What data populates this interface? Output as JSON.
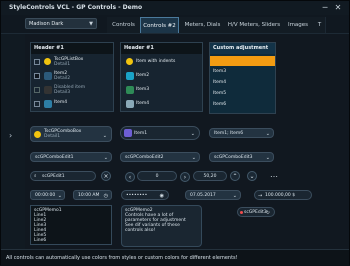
{
  "window": {
    "title": "StyleControls VCL - GP Controls - Demo"
  },
  "style_selector": {
    "value": "Madison Dark"
  },
  "tabs": [
    "Controls",
    "Controls #2",
    "Meters, Dials",
    "H/V Meters, Sliders",
    "Images",
    "T"
  ],
  "headers": {
    "h1": "Header #1",
    "h2": "Header #1"
  },
  "list1": [
    {
      "title": "TscGPListBox",
      "sub": "Detail1"
    },
    {
      "title": "Item2",
      "sub": "Detail2"
    },
    {
      "title": "Disabled item",
      "sub": "Detail3"
    },
    {
      "title": "Item4",
      "sub": ""
    }
  ],
  "list2": [
    {
      "title": "Item with indents"
    },
    {
      "title": "Item2"
    },
    {
      "title": "Item3"
    },
    {
      "title": "Item4"
    }
  ],
  "list3": [
    {
      "title": "Custom adjustment"
    },
    {
      "title": "Item2"
    },
    {
      "title": "Item3"
    },
    {
      "title": "Item4"
    },
    {
      "title": "Item5"
    },
    {
      "title": "Item6"
    }
  ],
  "combo_left": {
    "title": "TscGPComboBox",
    "sub": "Detail1"
  },
  "combo_mid": "Item1",
  "combo_right": "Item1; Item6",
  "edits": {
    "edit1": "scGPComboEdit1",
    "edit2": "scGPComboEdit2",
    "edit3": "scGPComboEdit3"
  },
  "search": {
    "placeholder": "scGPEdit1"
  },
  "spin": {
    "value": "0",
    "value2": "50,20"
  },
  "time": {
    "t1": "00:00:00",
    "t2": "10:00 AM"
  },
  "password": "••••••••",
  "date": "07.05.2017",
  "numeric": "100.000,00 $",
  "memo1": [
    "scGPMemo1",
    "Line1",
    "Line2",
    "Line3",
    "Line4",
    "Line5",
    "Line6"
  ],
  "memo2": [
    "scGPMemo2",
    "Controls have a lot of parameters for adjustment",
    "See dif variants of these controls also!"
  ],
  "edit_right": "scGPEdit3",
  "bottom_text": "All controls can automatically use colors from styles or custom colors for different elements!"
}
